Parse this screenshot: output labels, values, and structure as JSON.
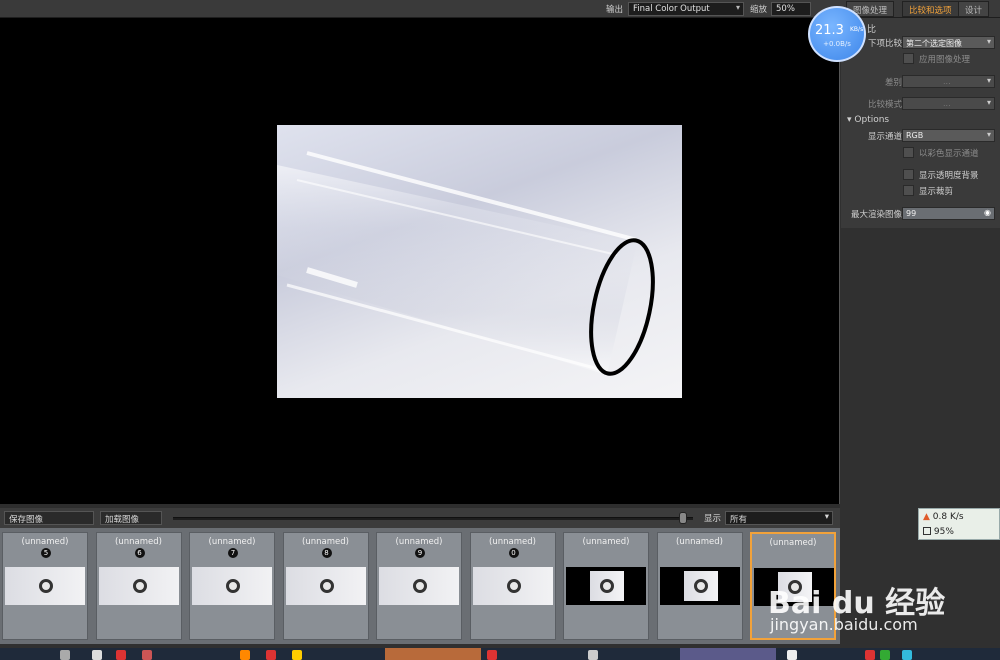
{
  "topbar": {
    "output_label": "输出",
    "output_value": "Final Color Output",
    "zoom_label": "缩放",
    "zoom_value": "50%",
    "tabs": [
      {
        "label": "图像处理"
      },
      {
        "label": "比较和选项"
      },
      {
        "label": "设计"
      }
    ]
  },
  "speed_widget": {
    "rate": "21.3",
    "unit": "KB/s",
    "secondary": "+0.0B/s"
  },
  "right_panel": {
    "compare_section": "比",
    "compare_label": "下项比较",
    "compare_value": "第二个选定图像",
    "apply_processing_label": "应用图像处理",
    "diff_label": "差别",
    "diff_value": "...",
    "compare_mode_label": "比较模式",
    "compare_mode_value": "...",
    "options_section": "Options",
    "channel_label": "显示通道",
    "channel_value": "RGB",
    "show_channel_color_label": "以彩色显示通道",
    "show_alpha_bg_label": "显示透明度背景",
    "show_clipping_label": "显示裁剪",
    "max_render_label": "最大渲染图像",
    "max_render_value": "99"
  },
  "lowerbar": {
    "save_button": "保存图像",
    "load_button": "加载图像",
    "show_label": "显示",
    "show_value": "所有",
    "slider_fraction": 0.98
  },
  "thumbnails": [
    {
      "name": "(unnamed)",
      "num": "5",
      "dark": false
    },
    {
      "name": "(unnamed)",
      "num": "6",
      "dark": false
    },
    {
      "name": "(unnamed)",
      "num": "7",
      "dark": false
    },
    {
      "name": "(unnamed)",
      "num": "8",
      "dark": false
    },
    {
      "name": "(unnamed)",
      "num": "9",
      "dark": false
    },
    {
      "name": "(unnamed)",
      "num": "0",
      "dark": false
    },
    {
      "name": "(unnamed)",
      "num": "",
      "dark": true
    },
    {
      "name": "(unnamed)",
      "num": "",
      "dark": true
    },
    {
      "name": "(unnamed)",
      "num": "",
      "dark": true,
      "selected": true
    }
  ],
  "status_box": {
    "upload": "0.8 K/s",
    "cpu": "95%"
  },
  "watermark": {
    "brand": "Bai du 经验",
    "url": "jingyan.baidu.com"
  },
  "colors": {
    "accent": "#f2a23a",
    "speed_bubble": "#3d86ea"
  }
}
